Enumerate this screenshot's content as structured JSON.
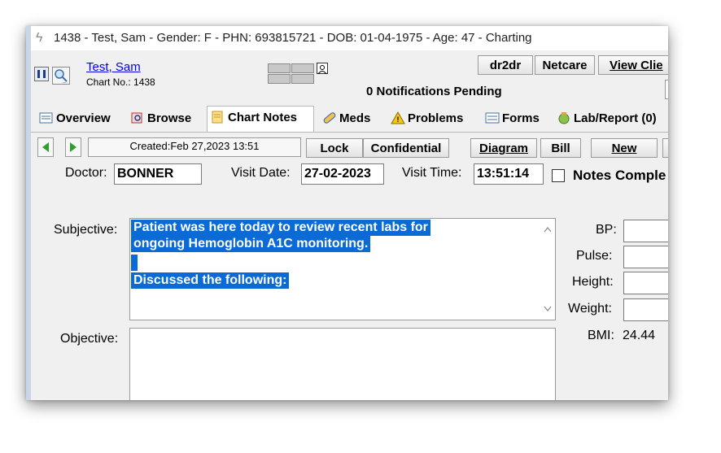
{
  "window": {
    "title": "1438 - Test, Sam - Gender: F - PHN: 693815721 - DOB: 01-04-1975 - Age: 47 - Charting"
  },
  "patient": {
    "name": "Test, Sam",
    "chart_no": "Chart No.: 1438"
  },
  "header": {
    "notifications": "0 Notifications Pending",
    "buttons": {
      "dr2dr": "dr2dr",
      "netcare": "Netcare",
      "view_client": "View Clie"
    }
  },
  "tabs": [
    {
      "label": "Overview",
      "icon": "overview-icon"
    },
    {
      "label": "Browse",
      "icon": "browse-icon"
    },
    {
      "label": "Chart Notes",
      "icon": "chart-notes-icon"
    },
    {
      "label": "Meds",
      "icon": "pill-icon"
    },
    {
      "label": "Problems",
      "icon": "warning-icon"
    },
    {
      "label": "Forms",
      "icon": "forms-icon"
    },
    {
      "label": "Lab/Report (0)",
      "icon": "lab-icon"
    }
  ],
  "toolbar": {
    "created": "Created:Feb 27,2023 13:51",
    "lock": "Lock",
    "confidential": "Confidential",
    "diagram": "Diagram",
    "bill": "Bill",
    "new": "New"
  },
  "visit": {
    "doctor_label": "Doctor:",
    "doctor": "BONNER",
    "visit_date_label": "Visit Date:",
    "visit_date": "27-02-2023",
    "visit_time_label": "Visit Time:",
    "visit_time": "13:51:14",
    "notes_complete_label": "Notes Comple"
  },
  "notes": {
    "subjective_label": "Subjective:",
    "subjective_line1": "Patient was here today to review recent labs for",
    "subjective_line2": "ongoing Hemoglobin A1C monitoring.",
    "subjective_line3": "Discussed the following:",
    "objective_label": "Objective:"
  },
  "vitals": {
    "bp_label": "BP:",
    "pulse_label": "Pulse:",
    "height_label": "Height:",
    "weight_label": "Weight:",
    "bmi_label": "BMI:",
    "bmi_value": "24.44"
  }
}
